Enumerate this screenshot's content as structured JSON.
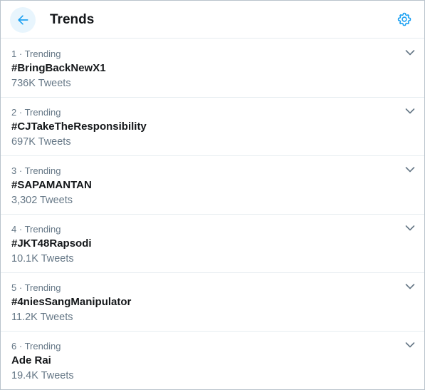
{
  "header": {
    "title": "Trends",
    "back_icon": "arrow-left-icon",
    "settings_icon": "gear-icon"
  },
  "colors": {
    "accent": "#1da1f2",
    "text_primary": "#14171a",
    "text_secondary": "#657786",
    "divider": "#e6ecf0"
  },
  "trends": [
    {
      "rank": "1",
      "separator": "·",
      "context": "Trending",
      "name": "#BringBackNewX1",
      "tweets": "736K Tweets"
    },
    {
      "rank": "2",
      "separator": "·",
      "context": "Trending",
      "name": "#CJTakeTheResponsibility",
      "tweets": "697K Tweets"
    },
    {
      "rank": "3",
      "separator": "·",
      "context": "Trending",
      "name": "#SAPAMANTAN",
      "tweets": "3,302 Tweets"
    },
    {
      "rank": "4",
      "separator": "·",
      "context": "Trending",
      "name": "#JKT48Rapsodi",
      "tweets": "10.1K Tweets"
    },
    {
      "rank": "5",
      "separator": "·",
      "context": "Trending",
      "name": "#4niesSangManipulator",
      "tweets": "11.2K Tweets"
    },
    {
      "rank": "6",
      "separator": "·",
      "context": "Trending",
      "name": "Ade Rai",
      "tweets": "19.4K Tweets"
    }
  ]
}
